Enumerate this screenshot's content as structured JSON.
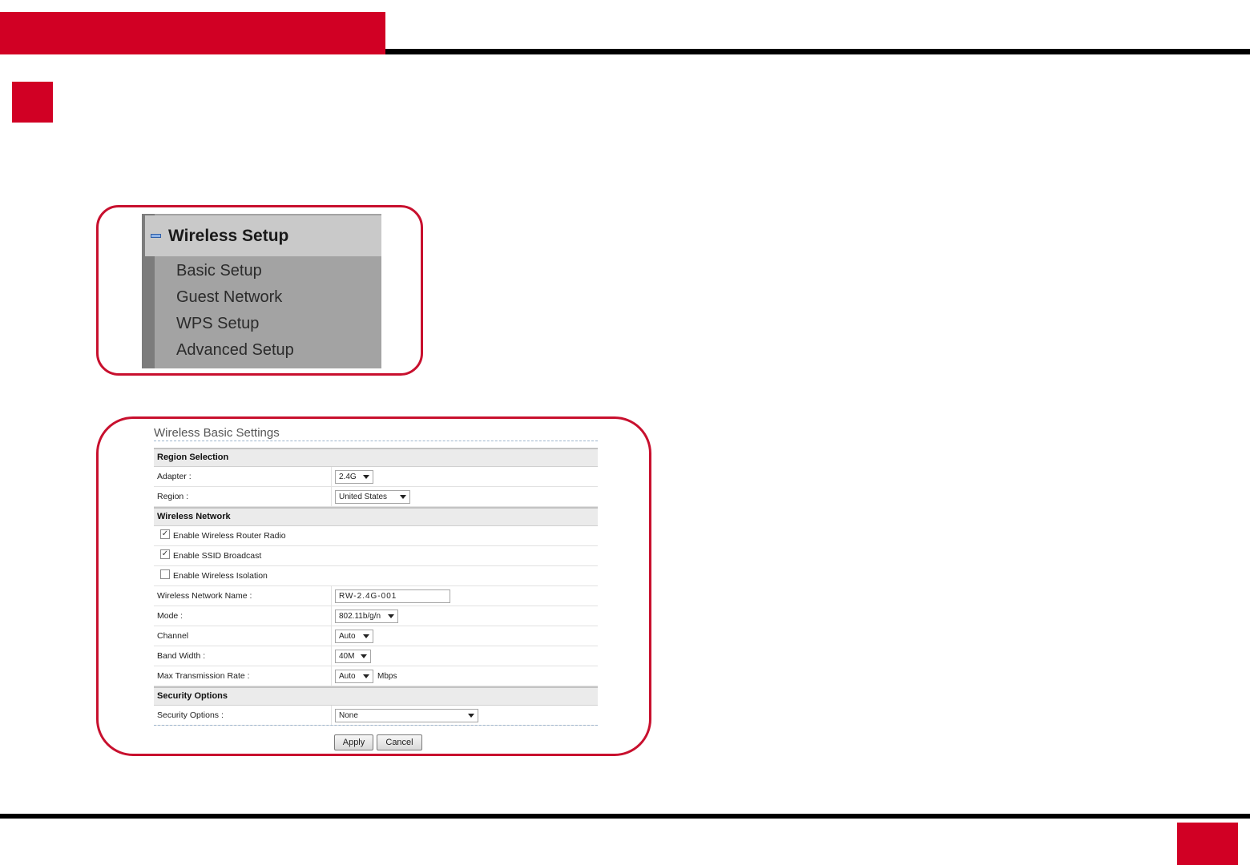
{
  "colors": {
    "accent": "#d10024",
    "border": "#c8102e"
  },
  "menu": {
    "title": "Wireless Setup",
    "items": [
      {
        "label": "Basic Setup"
      },
      {
        "label": "Guest Network"
      },
      {
        "label": "WPS Setup"
      },
      {
        "label": "Advanced Setup"
      }
    ]
  },
  "settings": {
    "title": "Wireless Basic Settings",
    "region_section": {
      "header": "Region Selection",
      "adapter_label": "Adapter :",
      "adapter_value": "2.4G",
      "region_label": "Region :",
      "region_value": "United States"
    },
    "network_section": {
      "header": "Wireless Network",
      "checks": [
        {
          "label": "Enable Wireless Router Radio",
          "checked": true
        },
        {
          "label": "Enable SSID Broadcast",
          "checked": true
        },
        {
          "label": "Enable Wireless Isolation",
          "checked": false
        }
      ],
      "name_label": "Wireless Network Name :",
      "name_value": "RW-2.4G-001",
      "mode_label": "Mode :",
      "mode_value": "802.11b/g/n",
      "channel_label": "Channel",
      "channel_value": "Auto",
      "bandwidth_label": "Band Width :",
      "bandwidth_value": "40M",
      "rate_label": "Max Transmission Rate :",
      "rate_value": "Auto",
      "rate_unit": "Mbps"
    },
    "security_section": {
      "header": "Security Options",
      "options_label": "Security Options :",
      "options_value": "None"
    },
    "apply_label": "Apply",
    "cancel_label": "Cancel"
  }
}
